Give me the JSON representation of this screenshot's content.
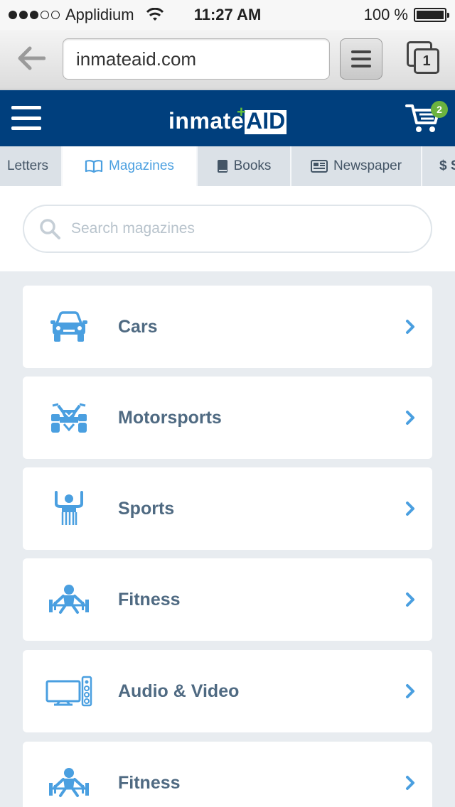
{
  "status_bar": {
    "carrier": "Applidium",
    "time": "11:27 AM",
    "battery": "100 %",
    "battery_level": 1.0,
    "signal_bars_filled": 3,
    "signal_bars_total": 5
  },
  "browser": {
    "url": "inmateaid.com",
    "tab_count": "1"
  },
  "app": {
    "logo_text": "inmate",
    "logo_accent": "AID",
    "cart_count": "2",
    "brand_color": "#003f7d",
    "accent_color": "#4a9fe0",
    "badge_color": "#6cb33f"
  },
  "tabs": [
    {
      "label": "Letters",
      "icon": "none"
    },
    {
      "label": "Magazines",
      "icon": "open-book-icon",
      "active": true
    },
    {
      "label": "Books",
      "icon": "book-icon"
    },
    {
      "label": "Newspaper",
      "icon": "newspaper-icon"
    },
    {
      "label": "$ S",
      "icon": "none"
    }
  ],
  "search": {
    "placeholder": "Search magazines"
  },
  "categories": [
    {
      "label": "Cars",
      "icon": "car-icon"
    },
    {
      "label": "Motorsports",
      "icon": "atv-icon"
    },
    {
      "label": "Sports",
      "icon": "referee-icon"
    },
    {
      "label": "Fitness",
      "icon": "weightlifter-icon"
    },
    {
      "label": "Audio & Video",
      "icon": "tv-speaker-icon"
    },
    {
      "label": "Fitness",
      "icon": "weightlifter-icon"
    }
  ]
}
